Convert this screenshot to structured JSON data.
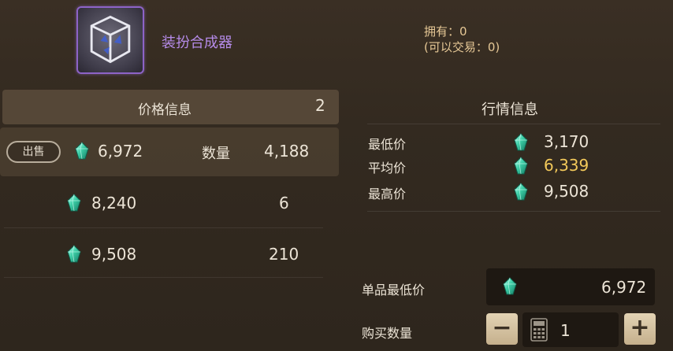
{
  "item": {
    "name": "装扮合成器",
    "owned_line": "拥有：0",
    "tradable_line": "(可以交易：0)"
  },
  "price_panel": {
    "title": "价格信息",
    "count": "2",
    "sell_label": "出售",
    "qty_label": "数量",
    "rows": [
      {
        "price": "6,972",
        "qty": "4,188"
      },
      {
        "price": "8,240",
        "qty": "6"
      },
      {
        "price": "9,508",
        "qty": "210"
      }
    ]
  },
  "market_panel": {
    "title": "行情信息",
    "rows": [
      {
        "label": "最低价",
        "value": "3,170"
      },
      {
        "label": "平均价",
        "value": "6,339"
      },
      {
        "label": "最高价",
        "value": "9,508"
      }
    ]
  },
  "purchase": {
    "unit_min_label": "单品最低价",
    "unit_min_value": "6,972",
    "qty_label": "购买数量",
    "qty_value": "1",
    "minus": "−",
    "plus": "+"
  },
  "colors": {
    "item_name": "#b58be8",
    "owned": "#e6c896",
    "avg_price": "#f2c85a",
    "gem": "#3fd0a8"
  },
  "icons": [
    "gem-currency-icon",
    "calculator-icon",
    "item-synthesizer-cube-icon"
  ]
}
